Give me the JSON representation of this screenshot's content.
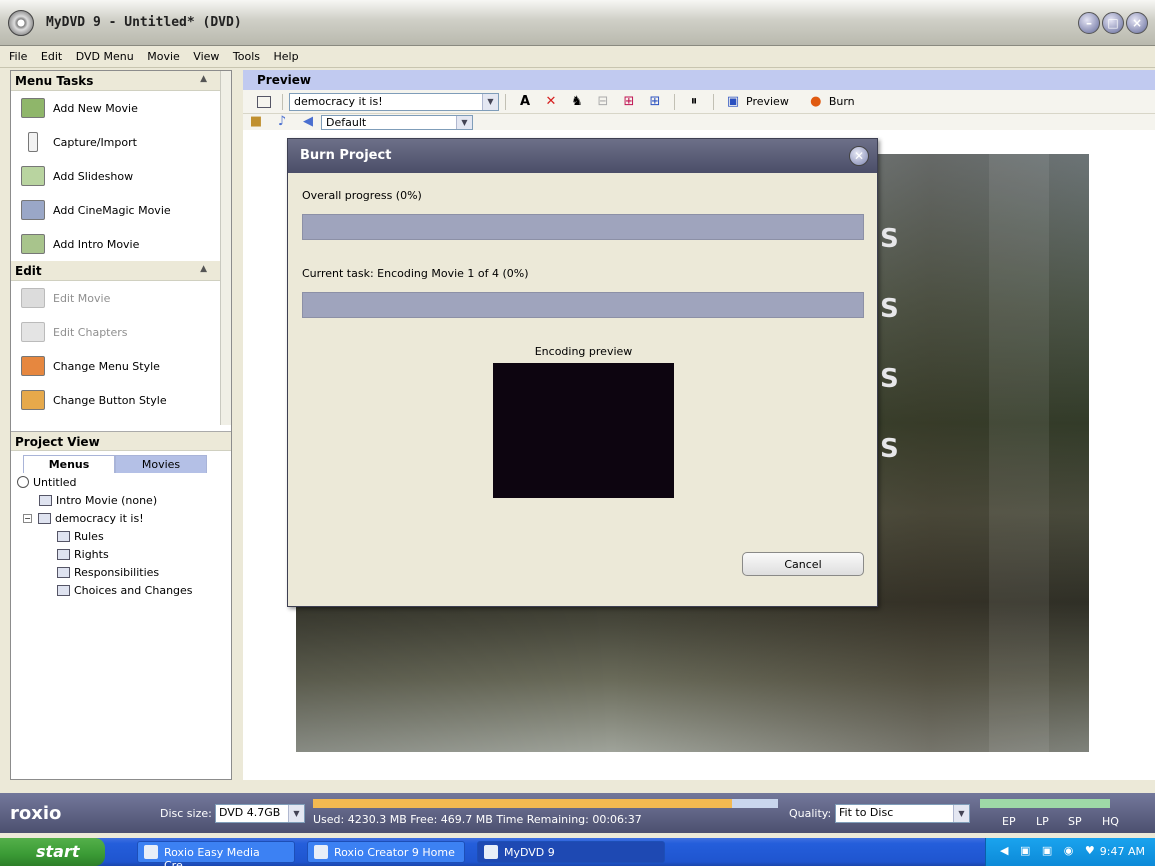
{
  "window": {
    "title": "MyDVD 9 - Untitled* (DVD)",
    "min": "–",
    "max": "□",
    "close": "×"
  },
  "menubar": [
    "File",
    "Edit",
    "DVD Menu",
    "Movie",
    "View",
    "Tools",
    "Help"
  ],
  "menu_tasks": {
    "header": "Menu Tasks",
    "items": [
      "Add New Movie",
      "Capture/Import",
      "Add Slideshow",
      "Add CineMagic Movie",
      "Add Intro Movie"
    ]
  },
  "edit": {
    "header": "Edit",
    "items": [
      "Edit Movie",
      "Edit Chapters",
      "Change Menu Style",
      "Change Button Style"
    ]
  },
  "project_view": {
    "header": "Project View",
    "tabs": [
      "Menus",
      "Movies"
    ],
    "tree": {
      "root": "Untitled",
      "intro": "Intro Movie (none)",
      "menu": "democracy it is!",
      "children": [
        "Rules",
        "Rights",
        "Responsibilities",
        "Choices and Changes"
      ]
    }
  },
  "preview": {
    "header": "Preview",
    "menu_select": "democracy it is!",
    "preview_btn": "Preview",
    "burn_btn": "Burn",
    "style_select": "Default",
    "letters": [
      "S",
      "S",
      "S",
      "S"
    ]
  },
  "burn_dialog": {
    "title": "Burn Project",
    "overall_label": "Overall progress (0%)",
    "overall_pct": 0,
    "task_label": "Current task: Encoding Movie 1 of 4 (0%)",
    "task_pct": 0,
    "encoding_label": "Encoding preview",
    "cancel": "Cancel"
  },
  "statusbar": {
    "logo": "roxio",
    "disc_label": "Disc size:",
    "disc_value": "DVD 4.7GB",
    "usage_text": "Used: 4230.3 MB  Free: 469.7 MB  Time Remaining: 00:06:37",
    "used_fraction": 0.9,
    "quality_label": "Quality:",
    "quality_value": "Fit to Disc",
    "modes": [
      "EP",
      "LP",
      "SP",
      "HQ"
    ]
  },
  "taskbar": {
    "start": "start",
    "items": [
      "Roxio Easy Media Cre...",
      "Roxio Creator 9 Home",
      "MyDVD 9"
    ],
    "clock": "9:47 AM"
  },
  "colors": {
    "accent": "#c1caf0",
    "taskbar": "#245edb",
    "disc_fill": "#f3b951"
  }
}
